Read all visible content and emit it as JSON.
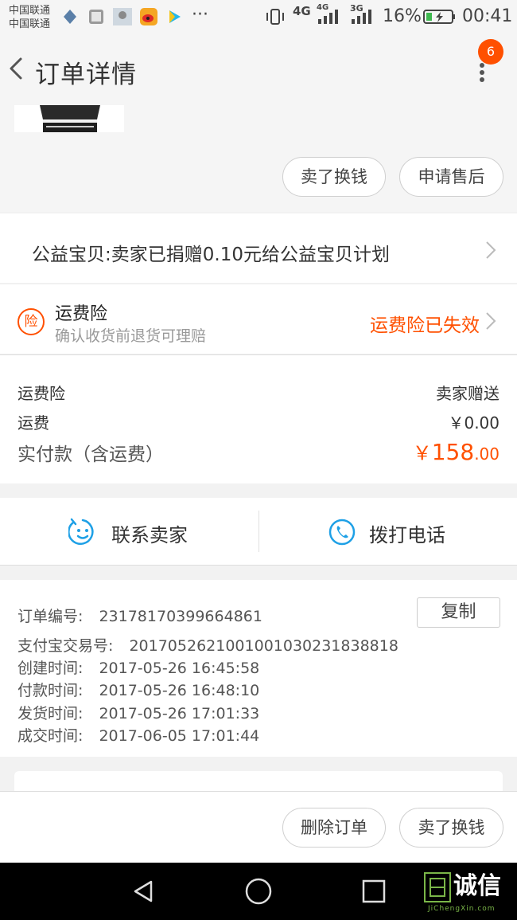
{
  "status_bar": {
    "carrier_1": "中国联通",
    "carrier_2": "中国联通",
    "network_1": "4G",
    "network_2": "4G",
    "network_3": "3G",
    "battery": "16%",
    "time": "00:41",
    "more_notifications": "···"
  },
  "header": {
    "title": "订单详情",
    "badge_count": "6"
  },
  "product": {
    "sell_button": "卖了换钱",
    "after_sale_button": "申请售后"
  },
  "charity": {
    "text": "公益宝贝:卖家已捐赠0.10元给公益宝贝计划"
  },
  "insurance": {
    "icon_label": "险",
    "title": "运费险",
    "subtitle": "确认收货前退货可理赔",
    "status": "运费险已失效"
  },
  "fees": {
    "insurance_label": "运费险",
    "insurance_value": "卖家赠送",
    "shipping_label": "运费",
    "shipping_value": "￥0.00",
    "total_label": "实付款（含运费）",
    "total_currency": "￥",
    "total_integer": "158",
    "total_decimal": ".00"
  },
  "contact": {
    "seller_label": "联系卖家",
    "phone_label": "拨打电话"
  },
  "order_info": {
    "order_no_label": "订单编号:",
    "order_no_value": "23178170399664861",
    "copy_button": "复制",
    "alipay_label": "支付宝交易号:",
    "alipay_value": "2017052621001001030231838818",
    "created_label": "创建时间:",
    "created_value": "2017-05-26 16:45:58",
    "paid_label": "付款时间:",
    "paid_value": "2017-05-26 16:48:10",
    "shipped_label": "发货时间:",
    "shipped_value": "2017-05-26 17:01:33",
    "completed_label": "成交时间:",
    "completed_value": "2017-06-05 17:01:44"
  },
  "bottom_actions": {
    "delete_order": "删除订单",
    "sell": "卖了换钱"
  },
  "watermark": {
    "text": "诚信",
    "sub": "JiChengXin.com"
  },
  "colors": {
    "accent": "#ff5000",
    "contact_icon": "#1ea0e6"
  }
}
